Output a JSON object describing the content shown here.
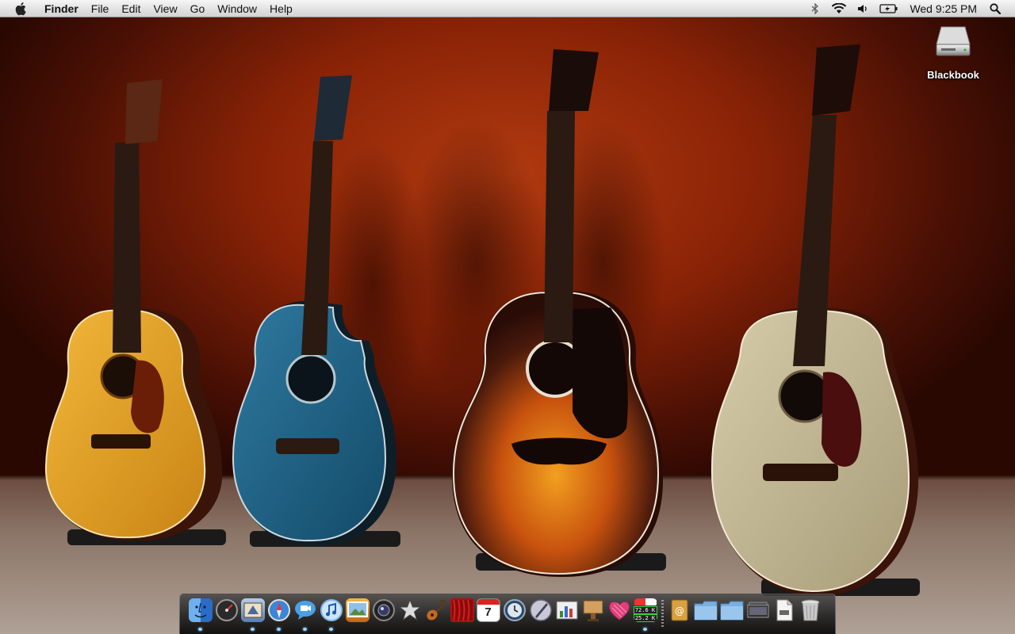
{
  "menubar": {
    "apple_icon": "apple-icon",
    "app_name": "Finder",
    "menus": [
      "File",
      "Edit",
      "View",
      "Go",
      "Window",
      "Help"
    ],
    "status_icons": [
      "bluetooth-icon",
      "wifi-icon",
      "volume-icon",
      "battery-icon"
    ],
    "clock": "Wed 9:25 PM",
    "spotlight_icon": "spotlight-search-icon"
  },
  "desktop": {
    "icons": [
      {
        "label": "Blackbook",
        "icon": "hard-drive-icon"
      }
    ]
  },
  "dock": {
    "apps": [
      {
        "name": "Finder",
        "icon": "finder-icon",
        "running": true,
        "color": "#4a8de0"
      },
      {
        "name": "Dashboard",
        "icon": "dashboard-icon",
        "running": false,
        "color": "#333333"
      },
      {
        "name": "Mail",
        "icon": "mail-icon",
        "running": true,
        "color": "#6b8fc4"
      },
      {
        "name": "Safari",
        "icon": "safari-icon",
        "running": true,
        "color": "#3a86d8"
      },
      {
        "name": "iChat",
        "icon": "ichat-icon",
        "running": true,
        "color": "#4aa0e8"
      },
      {
        "name": "iTunes",
        "icon": "itunes-icon",
        "running": true,
        "color": "#7fb7e8"
      },
      {
        "name": "iPhoto",
        "icon": "iphoto-icon",
        "running": false,
        "color": "#d98a2a"
      },
      {
        "name": "Aperture",
        "icon": "aperture-icon",
        "running": false,
        "color": "#222222"
      },
      {
        "name": "iMovie",
        "icon": "imovie-icon",
        "running": false,
        "color": "#c9c9c9"
      },
      {
        "name": "GarageBand",
        "icon": "garageband-icon",
        "running": false,
        "color": "#c46a1e"
      },
      {
        "name": "Photo Booth",
        "icon": "photo-booth-icon",
        "running": false,
        "color": "#b01010"
      },
      {
        "name": "iCal",
        "icon": "ical-icon",
        "running": false,
        "color": "#ffffff",
        "date": "7"
      },
      {
        "name": "Time Machine",
        "icon": "time-machine-icon",
        "running": false,
        "color": "#3a5a7a"
      },
      {
        "name": "Script Editor",
        "icon": "script-editor-icon",
        "running": false,
        "color": "#5a5a8a"
      },
      {
        "name": "Activity Monitor",
        "icon": "activity-monitor-icon",
        "running": false,
        "color": "#5aa0d8"
      },
      {
        "name": "Keynote",
        "icon": "keynote-icon",
        "running": false,
        "color": "#8a5a2a"
      },
      {
        "name": "Love Heart",
        "icon": "heart-icon",
        "running": false,
        "color": "#e0407a"
      },
      {
        "name": "Network Monitor",
        "icon": "network-monitor-icon",
        "running": true,
        "color": "#2a2a2a",
        "upload": "72.6 K",
        "download": "25.2 K"
      }
    ],
    "stacks": [
      {
        "name": "Address Book",
        "icon": "address-book-icon",
        "color": "#d9a040"
      },
      {
        "name": "Applications",
        "icon": "applications-folder-icon",
        "color": "#7ab0e0"
      },
      {
        "name": "Documents",
        "icon": "documents-folder-icon",
        "color": "#7ab0e0"
      },
      {
        "name": "Downloads",
        "icon": "downloads-stack-icon",
        "color": "#444444"
      },
      {
        "name": "Document",
        "icon": "document-icon",
        "color": "#e8e8e8"
      },
      {
        "name": "Trash",
        "icon": "trash-icon",
        "color": "#c8c8c8"
      }
    ]
  },
  "colors": {
    "wallpaper_base": "#8a2306",
    "dock_running_indicator": "#9fd4ff"
  }
}
